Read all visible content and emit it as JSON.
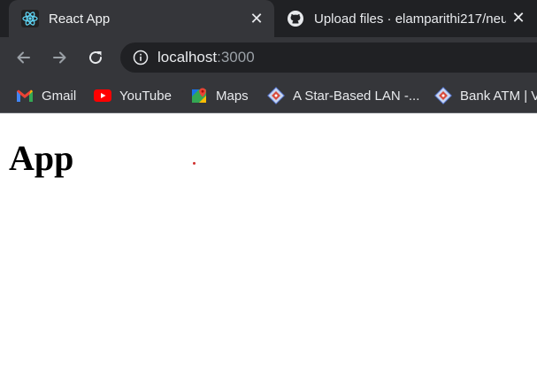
{
  "browser": {
    "tabs": [
      {
        "title": "React App",
        "favicon": "react-logo-icon",
        "active": true
      },
      {
        "title": "Upload files · elamparithi217/neu",
        "favicon": "github-logo-icon",
        "active": false
      }
    ],
    "close_glyph": "✕",
    "address_bar": {
      "host": "localhost",
      "port": ":3000"
    },
    "bookmarks": [
      {
        "label": "Gmail",
        "icon": "gmail-icon"
      },
      {
        "label": "YouTube",
        "icon": "youtube-icon"
      },
      {
        "label": "Maps",
        "icon": "maps-icon"
      },
      {
        "label": "A Star-Based LAN -...",
        "icon": "lan-site-icon"
      },
      {
        "label": "Bank ATM | V",
        "icon": "bank-site-icon"
      }
    ]
  },
  "page": {
    "heading": "App"
  },
  "colors": {
    "tabstrip": "#202124",
    "toolbar": "#35363a",
    "text_light": "#e8eaed",
    "react_blue": "#61dafb",
    "youtube_red": "#ff0000",
    "dot_red": "#d0302e"
  }
}
